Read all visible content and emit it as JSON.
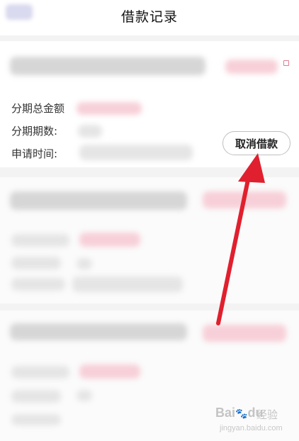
{
  "header": {
    "title": "借款记录"
  },
  "record": {
    "total_label": "分期总金额",
    "periods_label": "分期期数:",
    "apply_time_label": "申请时间:",
    "cancel_button": "取消借款"
  },
  "watermark": {
    "brand": "Bai",
    "brand_paw": "du",
    "cn": "经验",
    "url": "jingyan.baidu.com"
  },
  "colors": {
    "accent_arrow": "#e0202e",
    "pink_blur": "#f7cfd8"
  }
}
